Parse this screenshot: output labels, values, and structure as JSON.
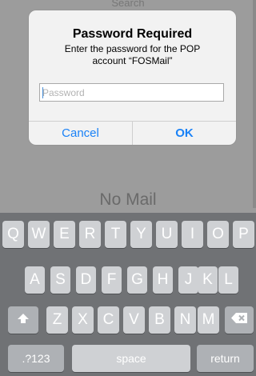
{
  "background": {
    "search_label": "Search",
    "empty_message": "No Mail"
  },
  "alert": {
    "title": "Password Required",
    "message_line1": "Enter the password for the POP",
    "message_line2": "account “FOSMail”",
    "field_placeholder": "Password",
    "field_value": "",
    "cancel_label": "Cancel",
    "ok_label": "OK"
  },
  "keyboard": {
    "row1": [
      "Q",
      "W",
      "E",
      "R",
      "T",
      "Y",
      "U",
      "I",
      "O",
      "P"
    ],
    "row2": [
      "A",
      "S",
      "D",
      "F",
      "G",
      "H",
      "J",
      "K",
      "L"
    ],
    "row3": [
      "Z",
      "X",
      "C",
      "V",
      "B",
      "N",
      "M"
    ],
    "shift_icon": "shift-up-arrow-icon",
    "delete_icon": "backspace-icon",
    "numbers_label": ".?123",
    "space_label": "space",
    "return_label": "return"
  },
  "colors": {
    "accent": "#1a82f7",
    "keyboard_bg": "#707275",
    "key_bg": "#cfd1d4"
  }
}
